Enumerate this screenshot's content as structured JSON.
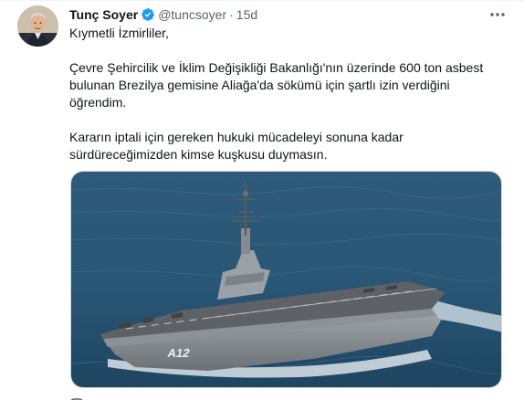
{
  "tweet": {
    "display_name": "Tunç Soyer",
    "handle": "@tuncsoyer",
    "separator": "·",
    "time": "15d",
    "paragraphs": [
      "Kıymetli İzmirliler,",
      "Çevre Şehircilik ve İklim Değişikliği Bakanlığı'nın üzerinde 600 ton asbest bulunan Brezilya gemisine Aliağa'da sökümü için şartlı izin verdiğini öğrendim.",
      "Kararın iptali için gereken hukuki mücadeleyi sonuna kadar sürdüreceğimizden kimse kuşkusu duymasın."
    ],
    "hull_number": "A12"
  },
  "icons": {
    "verified": "verified-badge-icon",
    "more": "more-options-icon",
    "reply": "reply-icon"
  },
  "colors": {
    "verified": "#1d9bf0",
    "secondary_text": "#536471",
    "primary_text": "#0f1419"
  }
}
